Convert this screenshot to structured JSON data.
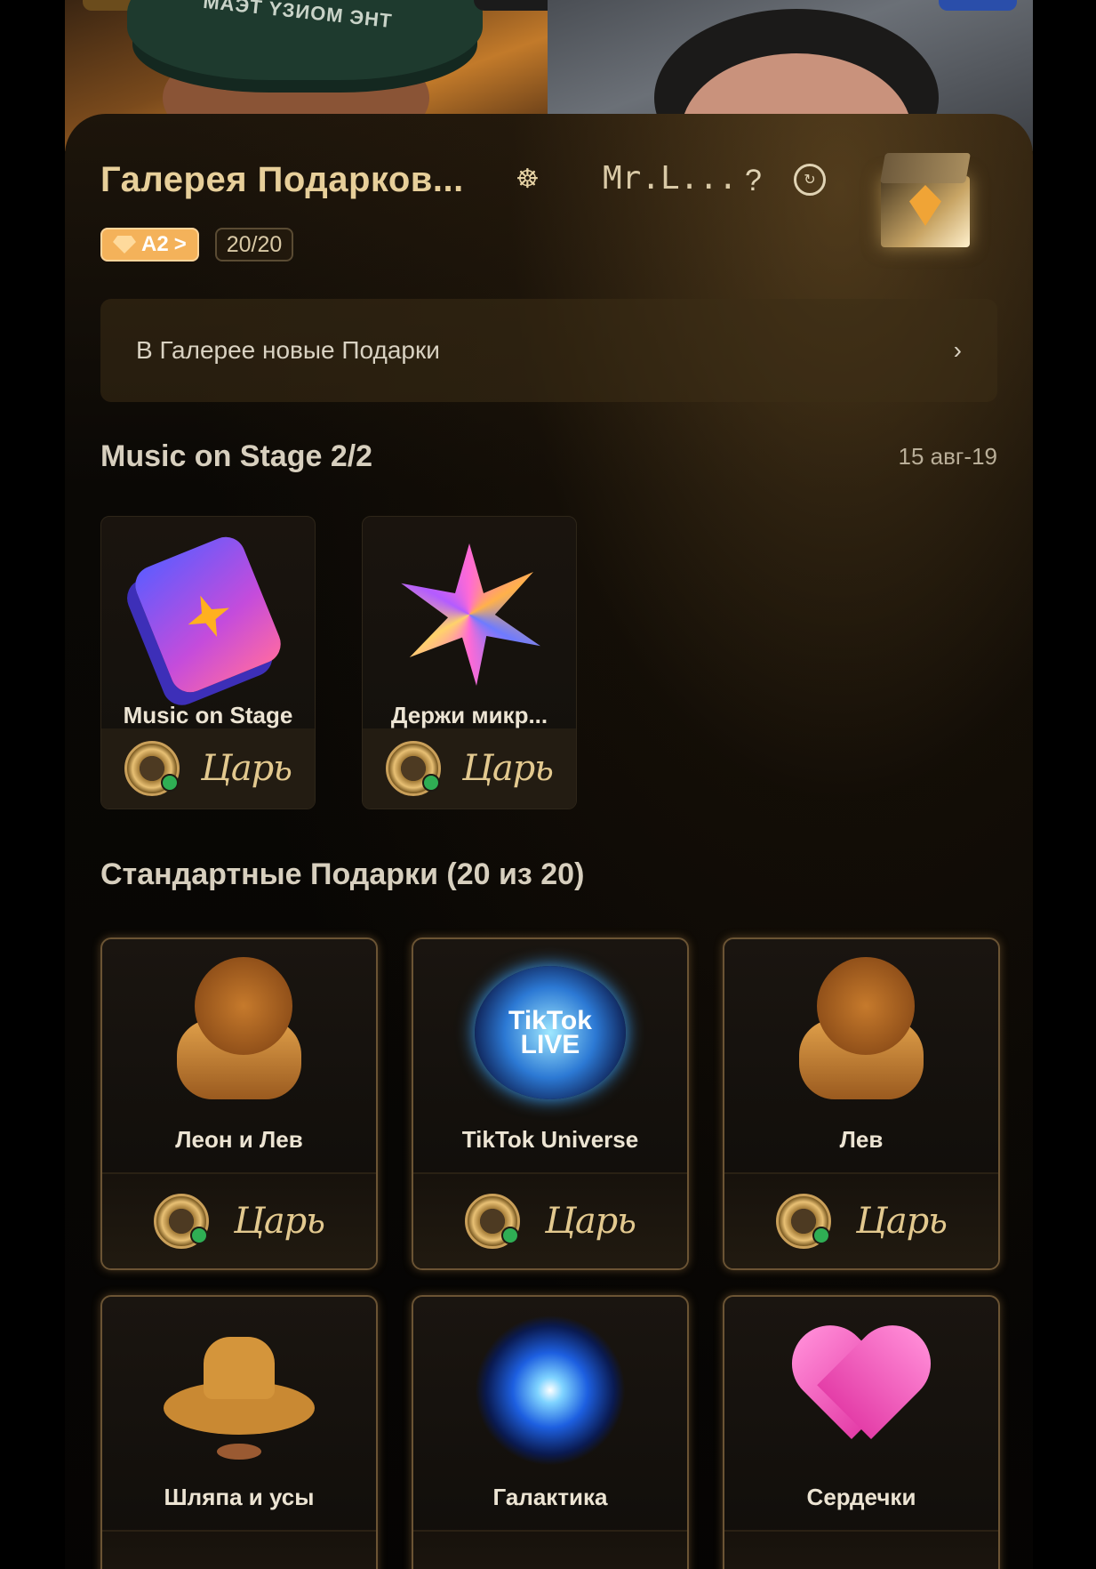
{
  "video": {
    "hat_text": "MAЭT YЗИOM ЭНТ"
  },
  "header": {
    "title": "Галерея Подарков...",
    "creator": "Mr.L...",
    "help": "?",
    "tier_badge": "A2",
    "tier_chevron": ">",
    "progress": "20/20"
  },
  "banner": {
    "text": "В Галерее новые Подарки",
    "chevron": "›"
  },
  "music_section": {
    "title": "Music on Stage 2/2",
    "date": "15 авг-19",
    "cards": [
      {
        "name": "Music on Stage",
        "signature": "Царь"
      },
      {
        "name": "Держи микр...",
        "signature": "Царь"
      }
    ]
  },
  "standard_section": {
    "title": "Стандартные Подарки (20 из 20)",
    "cards": [
      {
        "name": "Леон и Лев",
        "signature": "Царь"
      },
      {
        "name": "TikTok Universe",
        "signature": "Царь"
      },
      {
        "name": "Лев",
        "signature": "Царь"
      },
      {
        "name": "Шляпа и усы",
        "signature": ""
      },
      {
        "name": "Галактика",
        "signature": ""
      },
      {
        "name": "Сердечки",
        "signature": ""
      }
    ]
  },
  "icons": {
    "wheel": "wheel-icon",
    "help": "help-icon",
    "rotate": "replay-icon",
    "cube": "gallery-cube-icon"
  },
  "colors": {
    "gold_text": "#e7cf9a",
    "badge_orange": "#f4b25a",
    "card_border": "#6b5434"
  }
}
